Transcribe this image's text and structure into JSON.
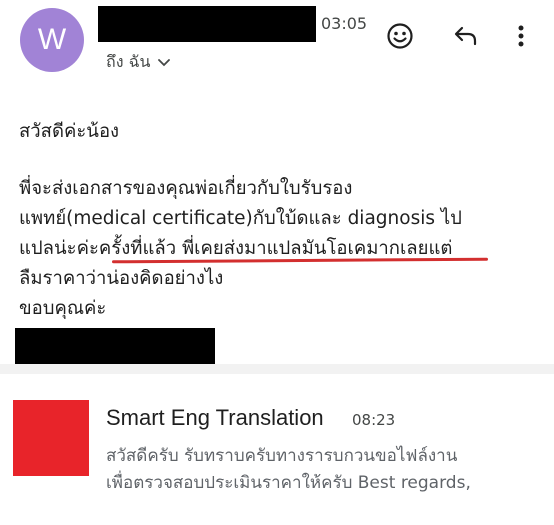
{
  "header": {
    "avatar_letter": "W",
    "time": "03:05",
    "recipient": "ถึง ฉัน",
    "icons": [
      "smiley-icon",
      "reply-icon",
      "more-vert-icon"
    ]
  },
  "message": {
    "greeting": "สวัสดีค่ะน้อง",
    "line1": "พี่จะส่งเอกสารของคุณพ่อเกี่ยวกับใบรับรอง",
    "line2": "แพทย์(medical certificate)กับใบ้ดและ diagnosis ไป",
    "line3": "แปลน่ะค่ะครั้งที่แล้ว พี่เคยส่งมาแปลมันโอเคมากเลยแต่",
    "line4": "ลืมราคาว่าน่องคิดอย่างไง",
    "closing": "ขอบคุณค่ะ"
  },
  "thread": {
    "sender": "Smart Eng Translation",
    "time": "08:23",
    "snippet_line1": "สวัสดีครับ รับทราบครับทางรารบกวนขอไฟล์งาน",
    "snippet_line2": "เพื่อตรวจสอบประเมินราคาให้ครับ Best regards,"
  },
  "colors": {
    "avatar": "#a183d6",
    "annotation_underline": "#d32f2f",
    "thumbnail": "#e8242a"
  }
}
